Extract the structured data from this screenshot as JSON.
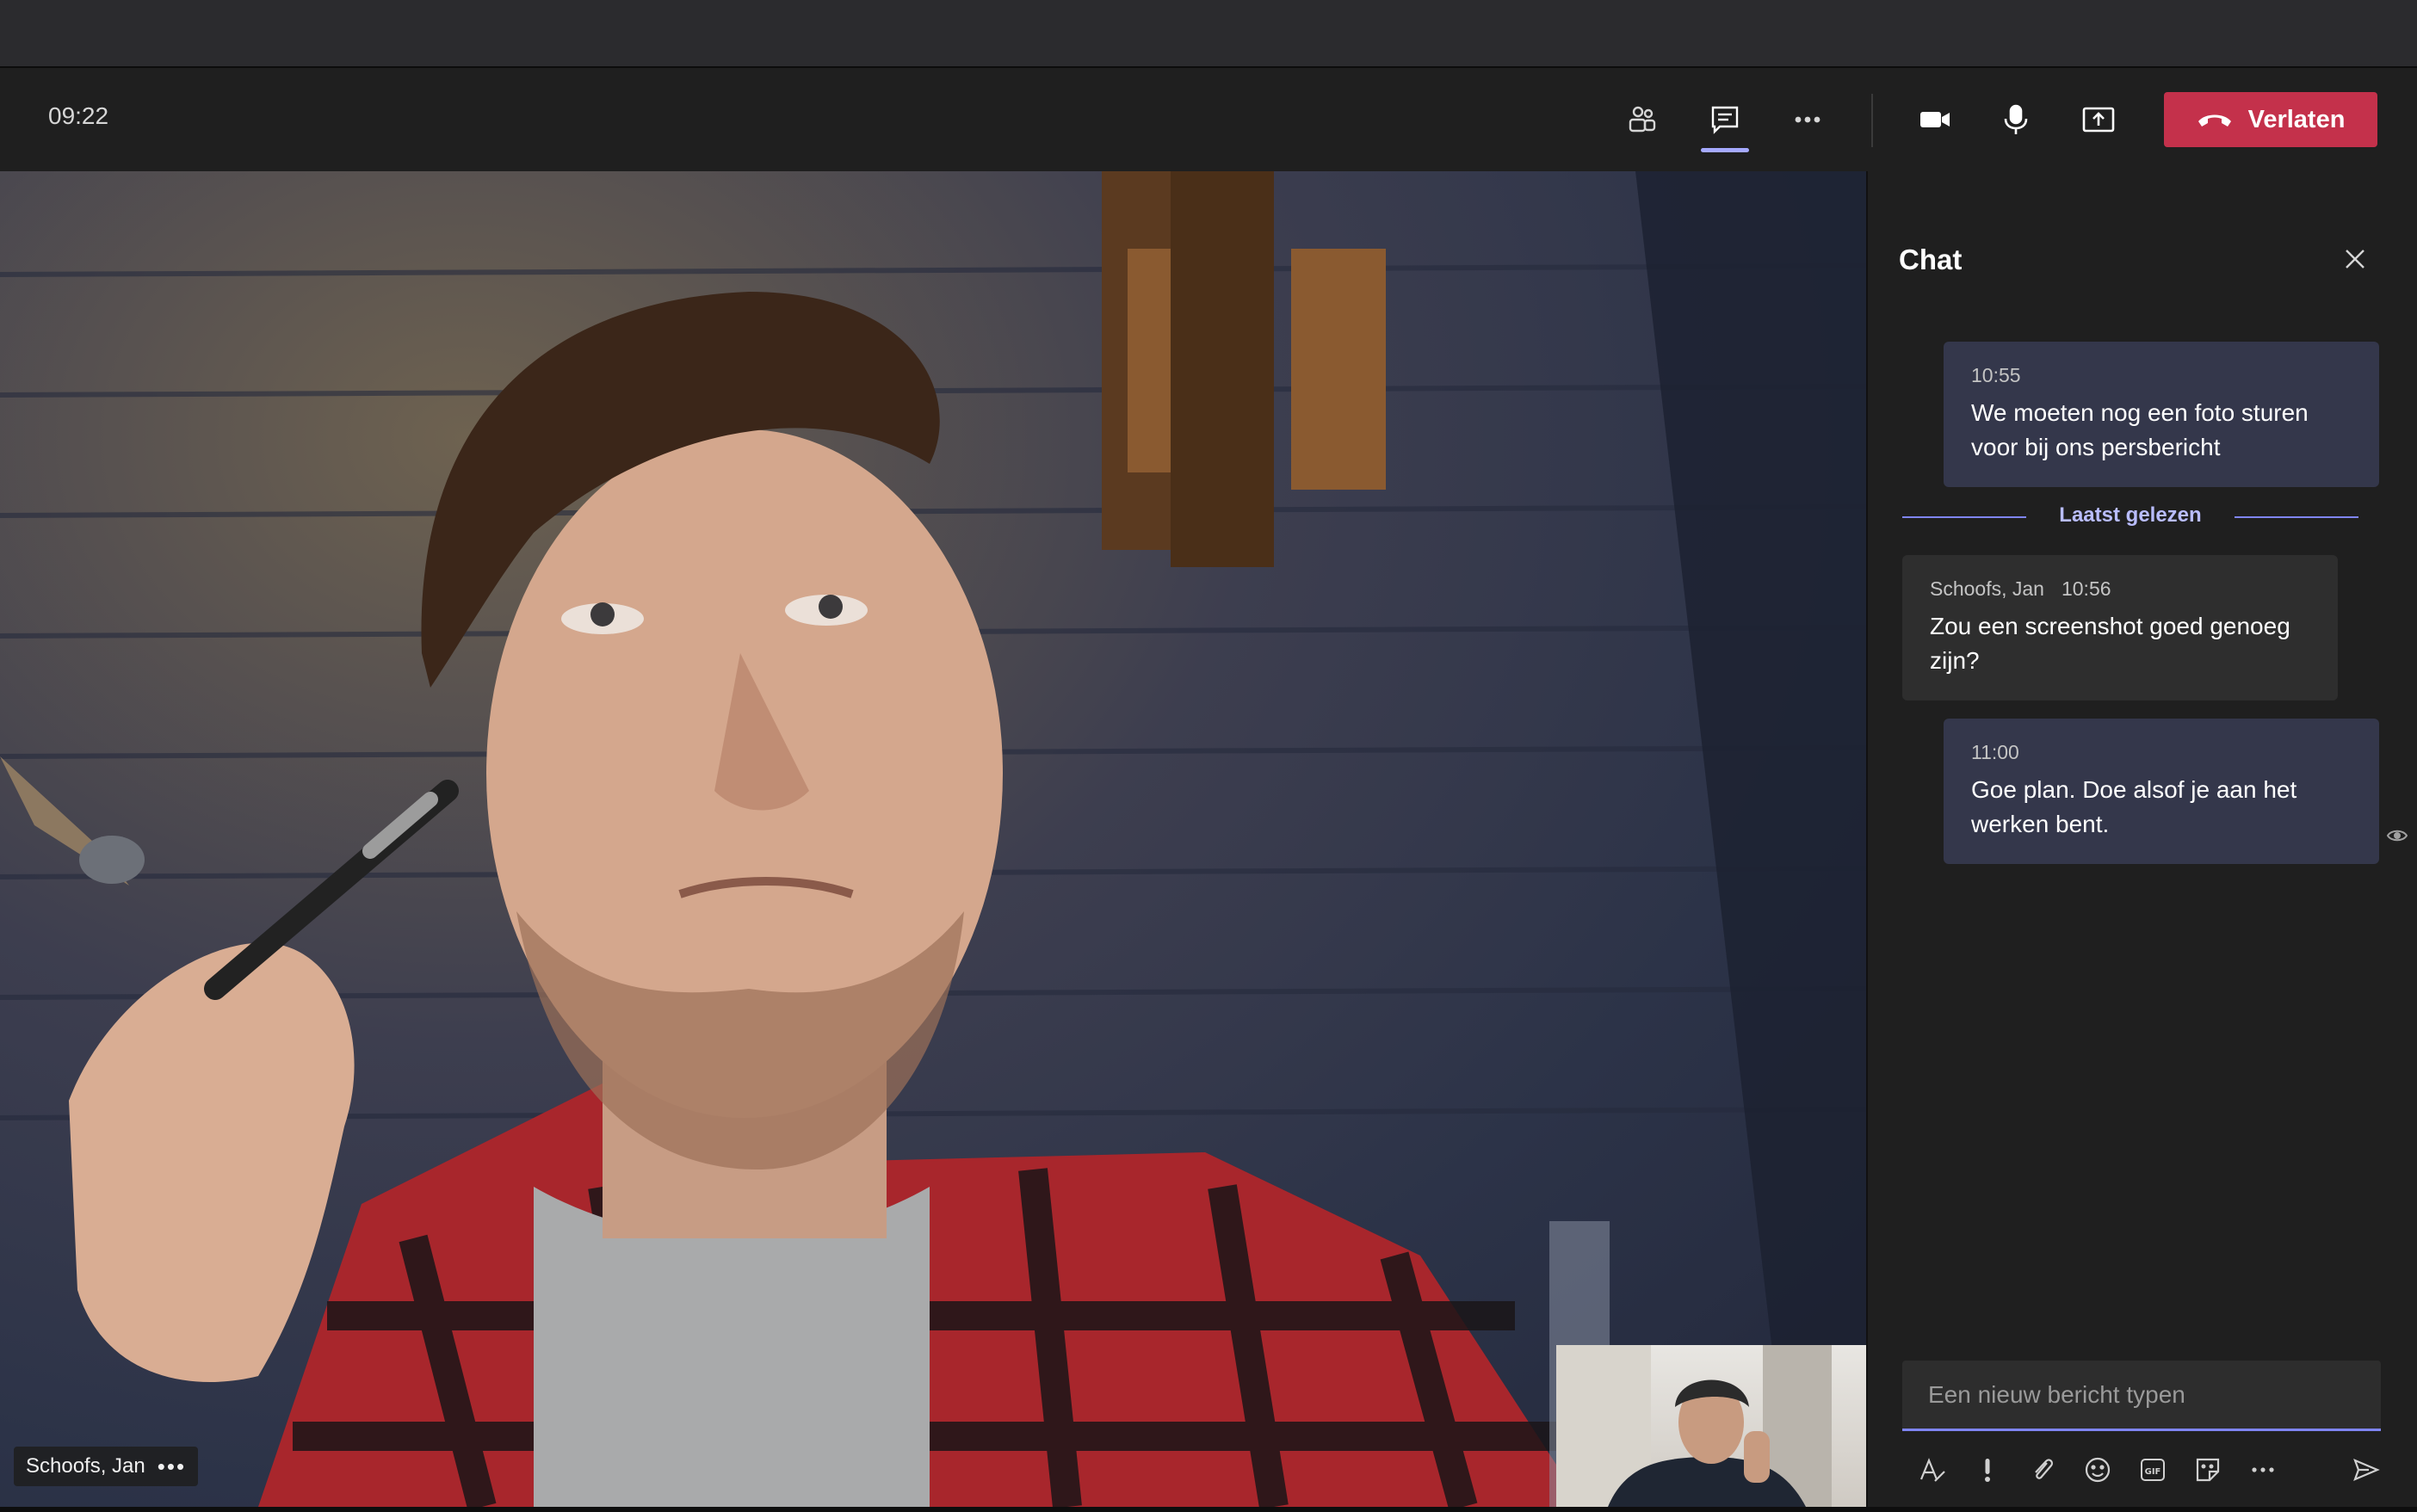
{
  "toolbar": {
    "timer": "09:22",
    "leave_label": "Verlaten",
    "leave_color": "#c4314b",
    "icons": [
      "participants-icon",
      "chat-icon",
      "more-icon",
      "camera-icon",
      "microphone-icon",
      "share-screen-icon",
      "hang-up-icon"
    ]
  },
  "video": {
    "participant_name": "Schoofs, Jan",
    "more_label": "•••"
  },
  "chat": {
    "title": "Chat",
    "messages": [
      {
        "time": "10:55",
        "text": "We moeten nog een foto sturen voor bij ons persbericht"
      },
      {
        "author": "Schoofs, Jan",
        "time": "10:56",
        "text": "Zou een screenshot goed genoeg zijn?"
      },
      {
        "time": "11:00",
        "text": "Goe plan. Doe alsof je aan het werken bent."
      }
    ],
    "last_read_label": "Laatst gelezen",
    "compose_placeholder": "Een nieuw bericht typen",
    "accent_color": "#7f85f5"
  }
}
